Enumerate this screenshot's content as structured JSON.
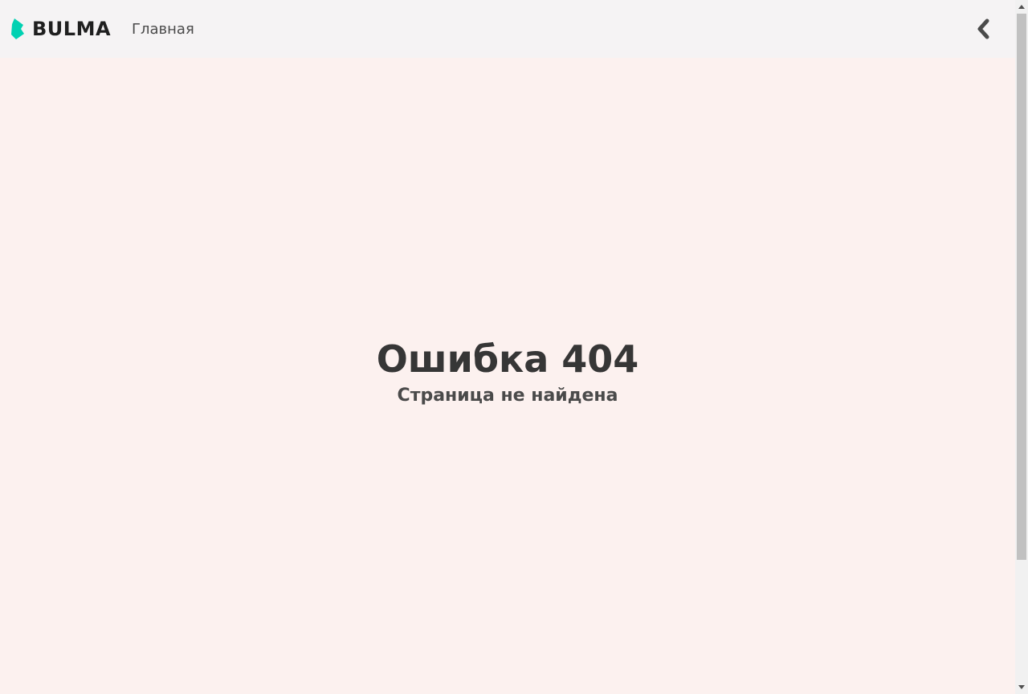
{
  "navbar": {
    "brand": {
      "text": "BULMA",
      "logo_color": "#00d1b2",
      "icon": "bulma-logo-icon"
    },
    "links": [
      {
        "label": "Главная"
      }
    ],
    "back_icon": "chevron-left-icon"
  },
  "main": {
    "title": "Ошибка 404",
    "subtitle": "Страница не найдена"
  },
  "scrollbar": {
    "up_icon": "scroll-up-arrow-icon",
    "down_icon": "scroll-down-arrow-icon",
    "position": 0
  },
  "colors": {
    "navbar_bg": "#f5f3f4",
    "page_bg": "#fcf1ef",
    "title": "#363636",
    "text": "#4a4a4a",
    "brand_accent": "#00d1b2"
  }
}
